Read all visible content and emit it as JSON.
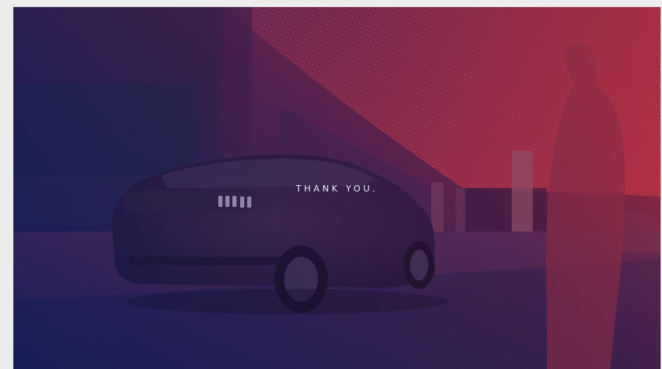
{
  "slide": {
    "message": "THANK YOU."
  },
  "colors": {
    "page_background": "#ececec",
    "gradient_blue": "#0c1e5f",
    "gradient_purple": "#3c2150",
    "gradient_red": "#be2d37",
    "text": "#f2eef4"
  }
}
